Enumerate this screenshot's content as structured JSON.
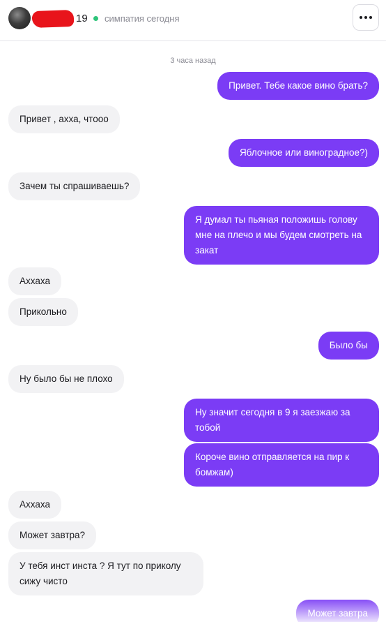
{
  "header": {
    "avatar_icon": "user-avatar-photo",
    "age": "19",
    "status": "симпатия сегодня",
    "menu_icon": "more-dots-icon"
  },
  "chat": {
    "timestamp": "3 часа назад",
    "messages": [
      {
        "side": "out",
        "text": "Привет. Тебе какое вино брать?"
      },
      {
        "side": "in",
        "text": "Привет , ахха, чтооо"
      },
      {
        "side": "out",
        "text": "Яблочное или виноградное?)"
      },
      {
        "side": "in",
        "text": "Зачем ты спрашиваешь?"
      },
      {
        "side": "out",
        "text": "Я думал ты пьяная положишь голову мне на плечо и мы будем смотреть на закат"
      },
      {
        "side": "in",
        "text": "Аххаха"
      },
      {
        "side": "in",
        "text": "Прикольно"
      },
      {
        "side": "out",
        "text": "Было бы"
      },
      {
        "side": "in",
        "text": "Ну было бы не плохо"
      },
      {
        "side": "out",
        "text": "Ну значит сегодня в 9 я заезжаю за тобой"
      },
      {
        "side": "out",
        "text": "Короче вино отправляется на пир к бомжам)"
      },
      {
        "side": "in",
        "text": "Аххаха"
      },
      {
        "side": "in",
        "text": "Может завтра?"
      },
      {
        "side": "in",
        "text": "У тебя инст инста ? Я тут по приколу сижу чисто"
      },
      {
        "side": "out",
        "text": "Может завтра"
      }
    ]
  },
  "colors": {
    "outgoing_bubble": "#7b3cf5",
    "incoming_bubble": "#f2f2f4",
    "online_indicator": "#2ec47a",
    "name_redaction": "#e8141b"
  }
}
